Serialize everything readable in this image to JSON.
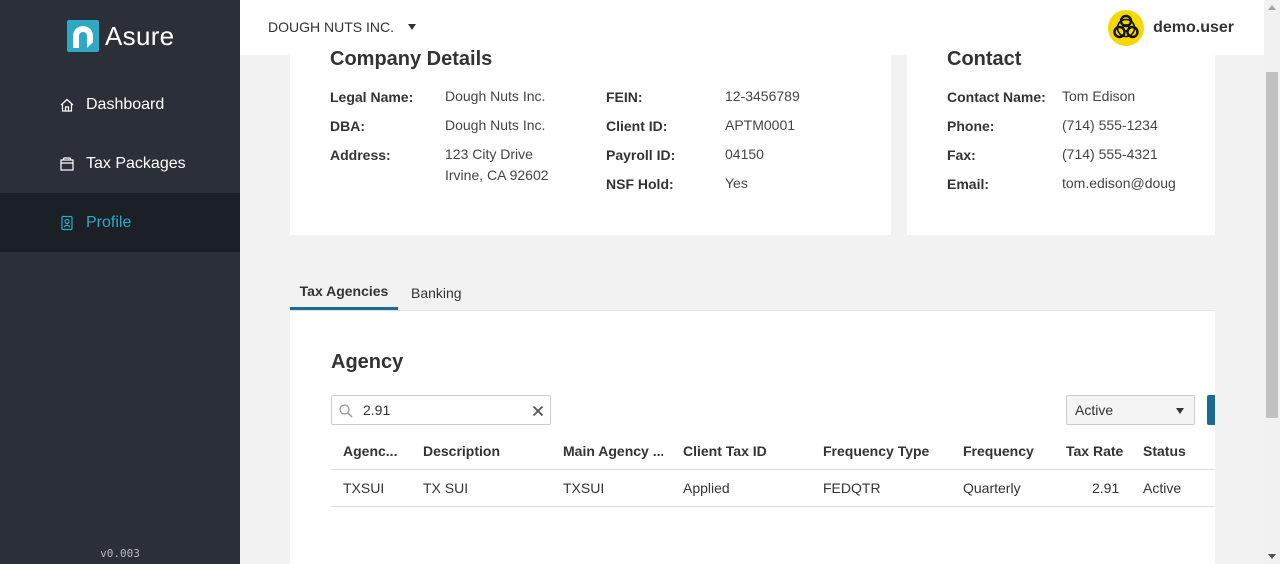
{
  "app": {
    "logo_text": "Asure",
    "version": "v0.003"
  },
  "sidebar": {
    "items": [
      {
        "label": "Dashboard",
        "icon": "home-icon"
      },
      {
        "label": "Tax Packages",
        "icon": "package-icon"
      },
      {
        "label": "Profile",
        "icon": "profile-icon",
        "active": true
      }
    ]
  },
  "header": {
    "company": "DOUGH NUTS INC.",
    "user": "demo.user",
    "avatar_icon": "biohazard-icon"
  },
  "company_details": {
    "title": "Company Details",
    "legal_name_label": "Legal Name:",
    "legal_name": "Dough Nuts Inc.",
    "dba_label": "DBA:",
    "dba": "Dough Nuts Inc.",
    "address_label": "Address:",
    "address_line1": "123 City Drive",
    "address_line2": "Irvine, CA 92602",
    "fein_label": "FEIN:",
    "fein": "12-3456789",
    "client_id_label": "Client ID:",
    "client_id": "APTM0001",
    "payroll_id_label": "Payroll ID:",
    "payroll_id": "04150",
    "nsf_hold_label": "NSF Hold:",
    "nsf_hold": "Yes"
  },
  "contact": {
    "title": "Contact",
    "name_label": "Contact Name:",
    "name": "Tom Edison",
    "phone_label": "Phone:",
    "phone": "(714) 555-1234",
    "fax_label": "Fax:",
    "fax": "(714) 555-4321",
    "email_label": "Email:",
    "email": "tom.edison@doug"
  },
  "tabs": [
    {
      "label": "Tax Agencies",
      "active": true
    },
    {
      "label": "Banking"
    }
  ],
  "agency": {
    "title": "Agency",
    "search_value": "2.91",
    "status_filter": "Active",
    "columns": [
      "Agenc...",
      "Description",
      "Main Agency ...",
      "Client Tax ID",
      "Frequency Type",
      "Frequency",
      "Tax Rate",
      "Status"
    ],
    "rows": [
      [
        "TXSUI",
        "TX SUI",
        "TXSUI",
        "Applied",
        "FEDQTR",
        "Quarterly",
        "2.91",
        "Active"
      ]
    ]
  },
  "colors": {
    "sidebar_bg": "#2b3038",
    "sidebar_active_bg": "#1b2027",
    "accent": "#2ea8c7",
    "primary_button": "#1a6a94"
  }
}
